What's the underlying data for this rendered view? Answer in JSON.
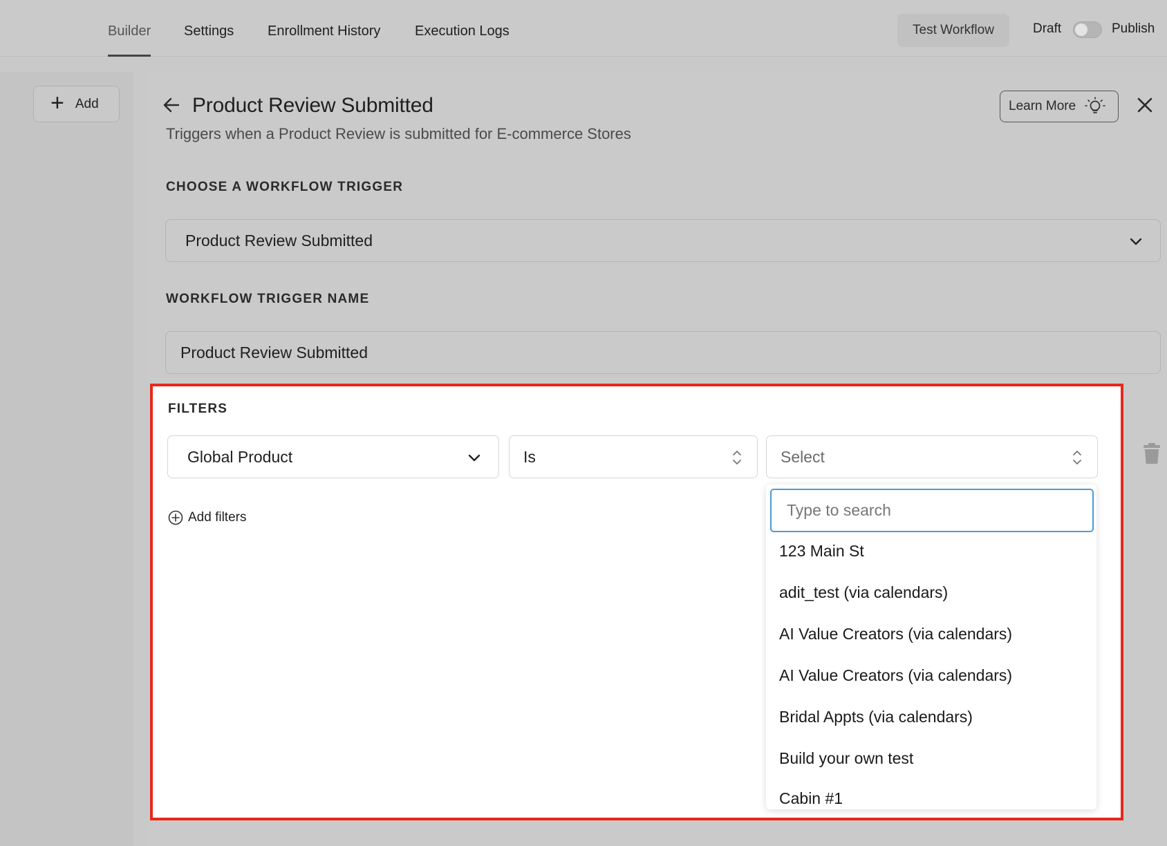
{
  "nav": {
    "tabs": [
      {
        "label": "Builder",
        "active": true
      },
      {
        "label": "Settings"
      },
      {
        "label": "Enrollment History"
      },
      {
        "label": "Execution Logs"
      }
    ],
    "test_workflow_label": "Test Workflow",
    "draft_label": "Draft",
    "publish_label": "Publish",
    "publish_toggle_on": false
  },
  "sidebar": {
    "add_label": "Add"
  },
  "panel": {
    "title": "Product Review Submitted",
    "subtitle": "Triggers when a Product Review is submitted for E-commerce Stores",
    "learn_more_label": "Learn More",
    "trigger_section_label": "CHOOSE A WORKFLOW TRIGGER",
    "trigger_value": "Product Review Submitted",
    "name_section_label": "WORKFLOW TRIGGER NAME",
    "name_value": "Product Review Submitted"
  },
  "filters": {
    "label": "FILTERS",
    "field_value": "Global Product",
    "operator_value": "Is",
    "value_placeholder": "Select",
    "add_filters_label": "Add filters",
    "dropdown": {
      "search_placeholder": "Type to search",
      "options": [
        "123 Main St",
        "adit_test (via calendars)",
        "AI Value Creators (via calendars)",
        "AI Value Creators (via calendars)",
        "Bridal Appts (via calendars)",
        "Build your own test",
        "Cabin #1"
      ]
    }
  },
  "colors": {
    "highlight_border": "#e8271c",
    "search_focus": "#4a9ad4"
  }
}
